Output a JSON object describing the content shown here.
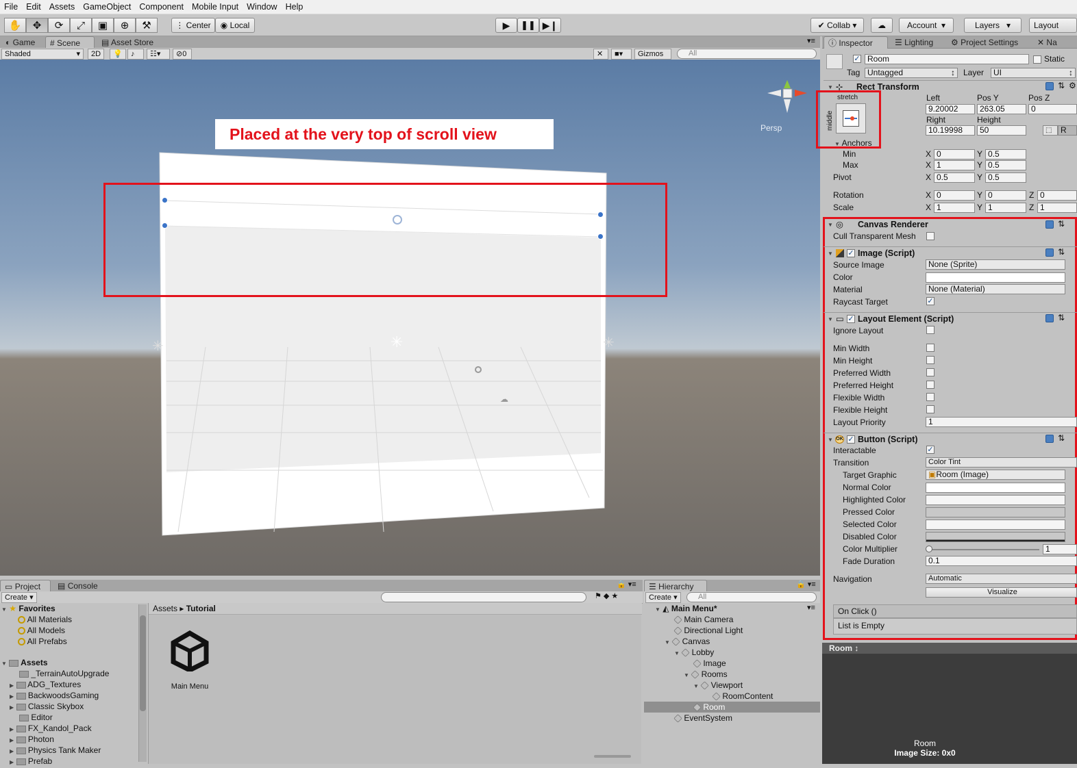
{
  "menu": [
    "File",
    "Edit",
    "Assets",
    "GameObject",
    "Component",
    "Mobile Input",
    "Window",
    "Help"
  ],
  "toolbar": {
    "pivot": "Center",
    "space": "Local",
    "collab": "Collab",
    "account": "Account",
    "layers": "Layers",
    "layout": "Layout"
  },
  "scene_tabs": [
    "Game",
    "Scene",
    "Asset Store"
  ],
  "scene_strip": {
    "shading": "Shaded",
    "mode2d": "2D",
    "hidden_count": "0",
    "gizmos": "Gizmos",
    "search": "All",
    "persp": "Persp"
  },
  "annotation": "Placed at the very top of scroll view",
  "inspector_tabs": [
    "Inspector",
    "Lighting",
    "Project Settings",
    "Na"
  ],
  "inspector": {
    "object_name": "Room",
    "static": "Static",
    "tag_label": "Tag",
    "tag": "Untagged",
    "layer_label": "Layer",
    "layer": "UI",
    "rect_transform": {
      "title": "Rect Transform",
      "anchor_preset_h": "stretch",
      "anchor_preset_v": "middle",
      "left_label": "Left",
      "left": "9.20002",
      "posy_label": "Pos Y",
      "posy": "263.05",
      "posz_label": "Pos Z",
      "posz": "0",
      "right_label": "Right",
      "right": "10.19998",
      "height_label": "Height",
      "height": "50",
      "r_btn": "R",
      "anchors": "Anchors",
      "min": "Min",
      "min_x": "0",
      "min_y": "0.5",
      "max": "Max",
      "max_x": "1",
      "max_y": "0.5",
      "pivot": "Pivot",
      "pivot_x": "0.5",
      "pivot_y": "0.5",
      "rotation": "Rotation",
      "rot_x": "0",
      "rot_y": "0",
      "rot_z": "0",
      "scale": "Scale",
      "scale_x": "1",
      "scale_y": "1",
      "scale_z": "1",
      "x": "X",
      "y": "Y",
      "z": "Z"
    },
    "canvas_renderer": {
      "title": "Canvas Renderer",
      "cull": "Cull Transparent Mesh"
    },
    "image": {
      "title": "Image (Script)",
      "source_image": "Source Image",
      "source_value": "None (Sprite)",
      "color": "Color",
      "material": "Material",
      "material_value": "None (Material)",
      "raycast": "Raycast Target"
    },
    "layout_element": {
      "title": "Layout Element (Script)",
      "ignore": "Ignore Layout",
      "min_width": "Min Width",
      "min_height": "Min Height",
      "pref_width": "Preferred Width",
      "pref_height": "Preferred Height",
      "flex_width": "Flexible Width",
      "flex_height": "Flexible Height",
      "priority": "Layout Priority",
      "priority_value": "1"
    },
    "button": {
      "title": "Button (Script)",
      "interactable": "Interactable",
      "transition": "Transition",
      "transition_value": "Color Tint",
      "target": "Target Graphic",
      "target_value": "Room (Image)",
      "normal": "Normal Color",
      "highlighted": "Highlighted Color",
      "pressed": "Pressed Color",
      "selected": "Selected Color",
      "disabled": "Disabled Color",
      "multiplier": "Color Multiplier",
      "multiplier_value": "1",
      "fade": "Fade Duration",
      "fade_value": "0.1",
      "navigation": "Navigation",
      "navigation_value": "Automatic",
      "visualize": "Visualize",
      "onclick": "On Click ()",
      "list_empty": "List is Empty"
    }
  },
  "preview": {
    "tab": "Room",
    "name": "Room",
    "size": "Image Size: 0x0"
  },
  "project": {
    "tabs": [
      "Project",
      "Console"
    ],
    "create": "Create",
    "favorites": "Favorites",
    "fav_items": [
      "All Materials",
      "All Models",
      "All Prefabs"
    ],
    "assets": "Assets",
    "folders": [
      "_TerrainAutoUpgrade",
      "ADG_Textures",
      "BackwoodsGaming",
      "Classic Skybox",
      "Editor",
      "FX_Kandol_Pack",
      "Photon",
      "Physics Tank Maker",
      "Prefab"
    ],
    "breadcrumb_root": "Assets",
    "breadcrumb_leaf": "Tutorial",
    "asset_name": "Main Menu"
  },
  "hierarchy": {
    "tab": "Hierarchy",
    "create": "Create",
    "search": "All",
    "scene": "Main Menu*",
    "items": [
      "Main Camera",
      "Directional Light",
      "Canvas",
      "Lobby",
      "Image",
      "Rooms",
      "Viewport",
      "RoomContent",
      "Room",
      "EventSystem"
    ]
  },
  "colors": {
    "highlight_red": "#e3121b",
    "selection": "#8f8f8f"
  }
}
